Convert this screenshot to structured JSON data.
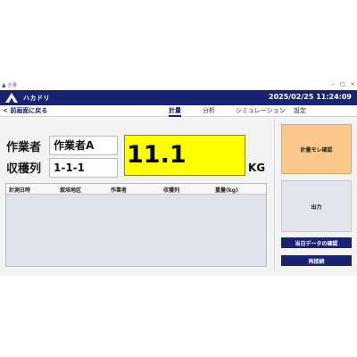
{
  "window": {
    "title": "計量"
  },
  "header": {
    "brand": "ハカドリ",
    "datetime": "2025/02/25 11:24:09"
  },
  "nav": {
    "back_label": "前画面に戻る",
    "tabs": [
      {
        "label": "計量",
        "active": true
      },
      {
        "label": "分析",
        "active": false
      },
      {
        "label": "シミュレーション",
        "active": false
      },
      {
        "label": "設定",
        "active": false
      }
    ]
  },
  "form": {
    "worker_label": "作業者",
    "worker_value": "作業者A",
    "row_label": "収穫列",
    "row_value": "1-1-1"
  },
  "scale": {
    "weight": "11.1",
    "unit": "KG"
  },
  "table": {
    "columns": [
      "計測日時",
      "栽培地区",
      "作業者",
      "収穫列",
      "重量(kg)"
    ],
    "rows": []
  },
  "actions": {
    "confirm_label": "計量モレ確認",
    "output_label": "出力",
    "today_data_label": "当日データの確認",
    "reconnect_label": "再接続"
  },
  "colors": {
    "header": "#1a2372",
    "weight_display": "#ffff00",
    "confirm_button": "#f9c98c"
  }
}
